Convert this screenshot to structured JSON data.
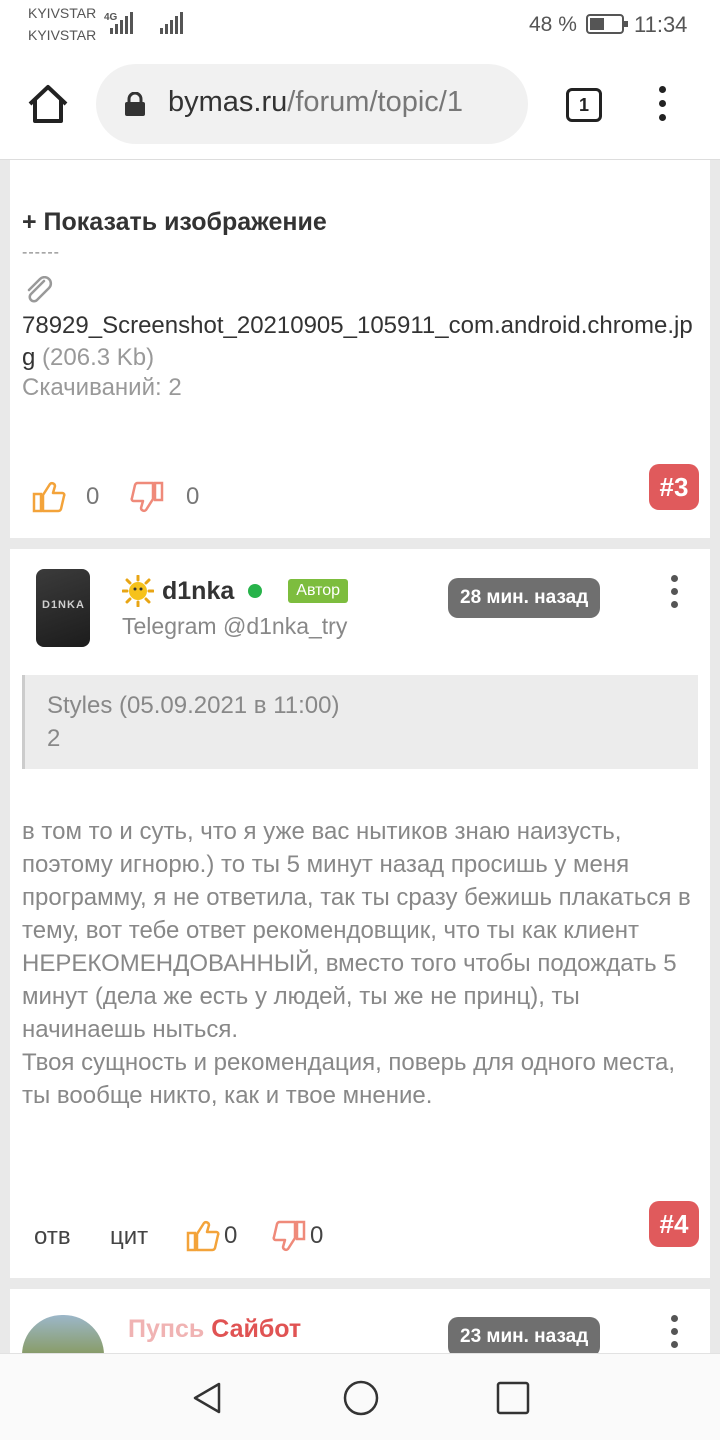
{
  "status_bar": {
    "carrier1": "KYIVSTAR",
    "carrier2": "KYIVSTAR",
    "network": "4G",
    "battery": "48 %",
    "battery_level": 0.48,
    "time": "11:34"
  },
  "browser": {
    "url_host": "bymas.ru",
    "url_path": "/forum/topic/1",
    "tab_count": "1",
    "icons": [
      "home-icon",
      "lock-icon",
      "tabs-icon",
      "overflow-menu-icon"
    ]
  },
  "post3": {
    "show_image": "+ Показать изображение",
    "separator": "------",
    "attachment_name": "78929_Screenshot_20210905_105911_com.android.chrome.jpg",
    "attachment_size": "(206.3 Kb)",
    "downloads": "Скачиваний: 2",
    "likes": "0",
    "dislikes": "0",
    "number": "#3"
  },
  "post4": {
    "avatar_text": "D1NKA",
    "username": "d1nka",
    "role_badge": "Автор",
    "signature": "Telegram @d1nka_try",
    "time": "28 мин. назад",
    "quote_header": "Styles (05.09.2021 в 11:00)",
    "quote_text": "2",
    "body": "в том то и суть, что я уже вас нытиков знаю наизусть, поэтому игнорю.) то ты 5 минут назад просишь у меня программу, я не ответила, так ты сразу бежишь плакаться в тему, вот тебе ответ рекомендовщик, что ты как клиент НЕРЕКОМЕНДОВАННЫЙ, вместо того чтобы подождать 5 минут (дела же есть у людей, ты же не принц), ты начинаешь ныться.\nТвоя сущность и рекомендация, поверь для одного места, ты вообще никто, как и твое мнение.",
    "reply_label": "отв",
    "quote_label": "цит",
    "likes": "0",
    "dislikes": "0",
    "number": "#4"
  },
  "post5": {
    "username_part1": "Пупсь",
    "username_part2": "Сайбот",
    "time": "23 мин. назад"
  },
  "colors": {
    "badge_red": "#e05a5c",
    "author_green": "#7dbd3e",
    "online_green": "#27b34a",
    "time_badge_gray": "#6f6f6f",
    "like_orange": "#f3a33a",
    "dislike_red": "#ef8a7a"
  }
}
